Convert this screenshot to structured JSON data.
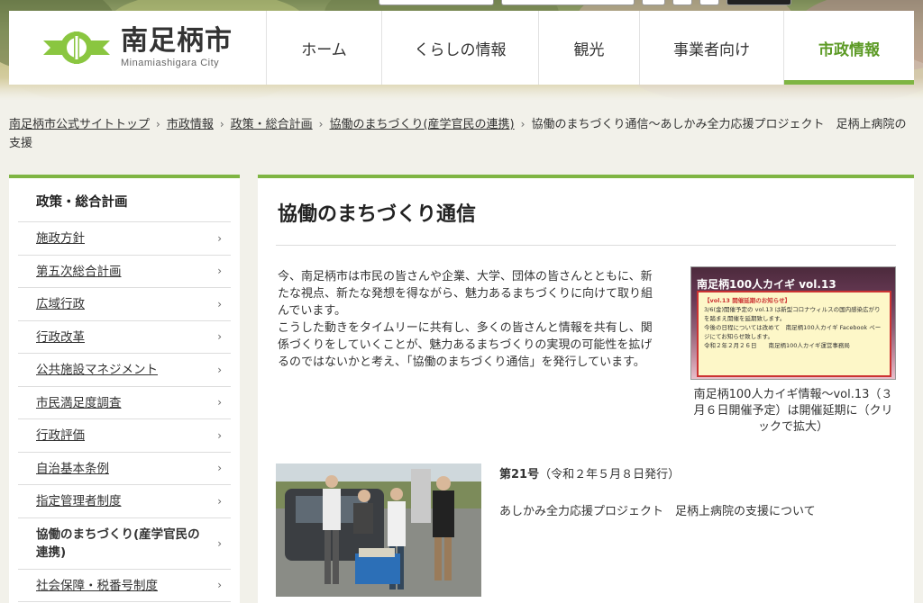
{
  "colors": {
    "accent": "#7fb543",
    "active_nav": "#5c9a25",
    "background": "#f2f1ea"
  },
  "logo": {
    "name_jp": "南足柄市",
    "name_en": "Minamiashigara City",
    "icon": "city-emblem-icon"
  },
  "nav": [
    {
      "label": "ホーム",
      "active": false
    },
    {
      "label": "くらしの情報",
      "active": false
    },
    {
      "label": "観光",
      "active": false
    },
    {
      "label": "事業者向け",
      "active": false
    },
    {
      "label": "市政情報",
      "active": true
    }
  ],
  "breadcrumb": {
    "items": [
      "南足柄市公式サイトトップ",
      "市政情報",
      "政策・総合計画",
      "協働のまちづくり(産学官民の連携)"
    ],
    "current": "協働のまちづくり通信～あしかみ全力応援プロジェクト　足柄上病院の支援"
  },
  "sidebar": {
    "title": "政策・総合計画",
    "items": [
      {
        "label": "施政方針"
      },
      {
        "label": "第五次総合計画"
      },
      {
        "label": "広域行政"
      },
      {
        "label": "行政改革"
      },
      {
        "label": "公共施設マネジメント"
      },
      {
        "label": "市民満足度調査"
      },
      {
        "label": "行政評価"
      },
      {
        "label": "自治基本条例"
      },
      {
        "label": "指定管理者制度"
      },
      {
        "label": "協働のまちづくり(産学官民の連携)"
      },
      {
        "label": "社会保障・税番号制度"
      }
    ]
  },
  "main": {
    "title": "協働のまちづくり通信",
    "intro": "今、南足柄市は市民の皆さんや企業、大学、団体の皆さんとともに、新たな視点、新たな発想を得ながら、魅力あるまちづくりに向けて取り組んでいます。\nこうした動きをタイムリーに共有し、多くの皆さんと情報を共有し、関係づくりをしていくことが、魅力あるまちづくりの実現の可能性を拡げるのではないかと考え、「協働のまちづくり通信」を発行しています。",
    "poster": {
      "title": "南足柄100人カイギ vol.13",
      "notice_head": "【vol.13 開催延期のお知らせ】",
      "notice_body": "3/6(金)開催予定の vol.13 は新型コロナウィルスの国内感染広がりを踏まえ開催を延期致します。",
      "notice_body2": "今後の日程については改めて　南足柄100人カイギ Facebook ページにてお知らせ致します。",
      "notice_date": "令和２年２月２６日　　南足柄100人カイギ運営事務局"
    },
    "promo_caption": "南足柄100人カイギ情報～vol.13（３月６日開催予定）は開催延期に（クリックで拡大）",
    "issue": {
      "number": "第21号",
      "date": "（令和２年５月８日発行）",
      "title": "あしかみ全力応援プロジェクト　足柄上病院の支援について"
    }
  }
}
